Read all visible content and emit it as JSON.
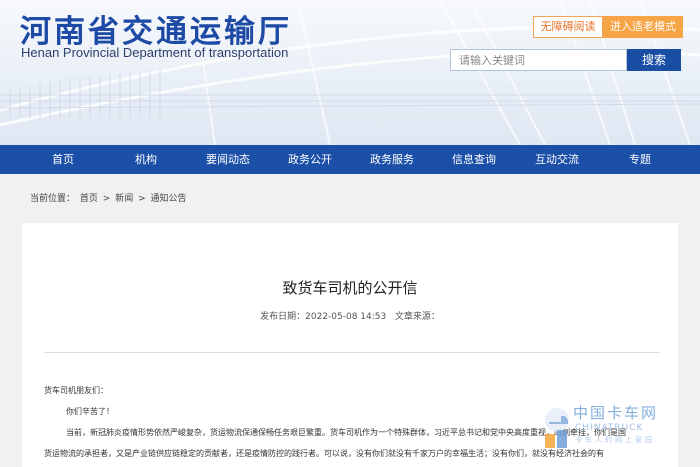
{
  "header": {
    "title": "河南省交通运输厅",
    "subtitle": "Henan Provincial Department of transportation",
    "accessibility_label": "无障碍阅读",
    "elder_mode_label": "进入适老模式",
    "search_placeholder": "请输入关键词",
    "search_label": "搜索"
  },
  "nav": {
    "items": [
      "首页",
      "机构",
      "要闻动态",
      "政务公开",
      "政务服务",
      "信息查询",
      "互动交流",
      "专题"
    ]
  },
  "breadcrumb": {
    "prefix": "当前位置：",
    "items": [
      "首页",
      "新闻",
      "通知公告"
    ],
    "separator": ">"
  },
  "article": {
    "title": "致货车司机的公开信",
    "publish_label": "发布日期：",
    "publish_date": "2022-05-08 14:53",
    "source_label": "文章来源：",
    "source": "",
    "paragraphs": [
      "货车司机朋友们：",
      "你们辛苦了！",
      "当前，新冠肺炎疫情形势依然严峻复杂，货运物流保通保畅任务艰巨繁重。货车司机作为一个特殊群体，习近平总书记和党中央高度重视，时刻牵挂，你们是国",
      "货运物流的承担者，又是产业链供应链稳定的贡献者，还是疫情防控的践行者。可以说，没有你们就没有千家万户的幸福生活；没有你们，就没有经济社会的有"
    ]
  },
  "watermark": {
    "cn": "中国卡车网",
    "en": "CHINATRUCK",
    "sub": "卡车人的网上家园"
  },
  "colors": {
    "brand_blue": "#1b4fa8",
    "accent_orange": "#f7a446"
  }
}
